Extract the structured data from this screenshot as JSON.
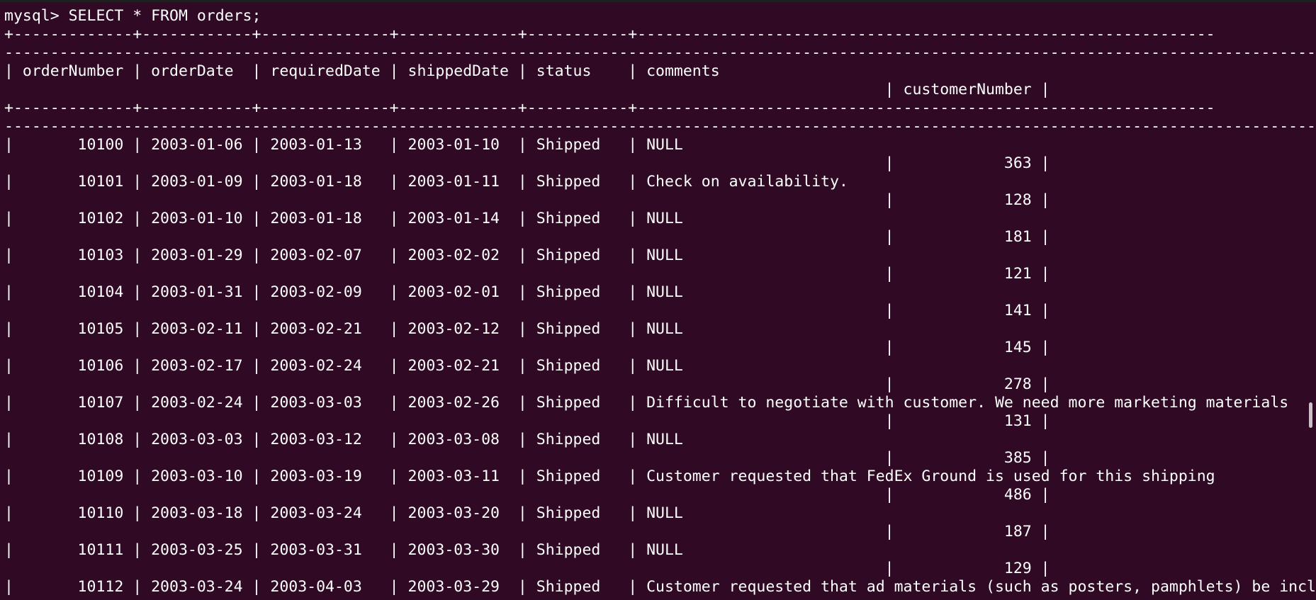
{
  "terminal": {
    "prompt": "mysql>",
    "command": "SELECT * FROM orders;",
    "border": "+-------------+------------+--------------+-------------+-----------+--------------------------------------------------------------------------------------------------------------------------------------------------------------------------------------------------------------------------------------------------------------+----------------+",
    "header_line1": "| orderNumber | orderDate  | requiredDate | shippedDate | status    | comments",
    "header_line2": "| customerNumber |",
    "scroll_position": 0.7,
    "colors": {
      "background": "#300a24",
      "foreground": "#ffffff"
    }
  },
  "table": {
    "columns": [
      "orderNumber",
      "orderDate",
      "requiredDate",
      "shippedDate",
      "status",
      "comments",
      "customerNumber"
    ],
    "rows": [
      {
        "orderNumber": "10100",
        "orderDate": "2003-01-06",
        "requiredDate": "2003-01-13",
        "shippedDate": "2003-01-10",
        "status": "Shipped",
        "comments": "NULL",
        "customerNumber": "363"
      },
      {
        "orderNumber": "10101",
        "orderDate": "2003-01-09",
        "requiredDate": "2003-01-18",
        "shippedDate": "2003-01-11",
        "status": "Shipped",
        "comments": "Check on availability.",
        "customerNumber": "128"
      },
      {
        "orderNumber": "10102",
        "orderDate": "2003-01-10",
        "requiredDate": "2003-01-18",
        "shippedDate": "2003-01-14",
        "status": "Shipped",
        "comments": "NULL",
        "customerNumber": "181"
      },
      {
        "orderNumber": "10103",
        "orderDate": "2003-01-29",
        "requiredDate": "2003-02-07",
        "shippedDate": "2003-02-02",
        "status": "Shipped",
        "comments": "NULL",
        "customerNumber": "121"
      },
      {
        "orderNumber": "10104",
        "orderDate": "2003-01-31",
        "requiredDate": "2003-02-09",
        "shippedDate": "2003-02-01",
        "status": "Shipped",
        "comments": "NULL",
        "customerNumber": "141"
      },
      {
        "orderNumber": "10105",
        "orderDate": "2003-02-11",
        "requiredDate": "2003-02-21",
        "shippedDate": "2003-02-12",
        "status": "Shipped",
        "comments": "NULL",
        "customerNumber": "145"
      },
      {
        "orderNumber": "10106",
        "orderDate": "2003-02-17",
        "requiredDate": "2003-02-24",
        "shippedDate": "2003-02-21",
        "status": "Shipped",
        "comments": "NULL",
        "customerNumber": "278"
      },
      {
        "orderNumber": "10107",
        "orderDate": "2003-02-24",
        "requiredDate": "2003-03-03",
        "shippedDate": "2003-02-26",
        "status": "Shipped",
        "comments": "Difficult to negotiate with customer. We need more marketing materials",
        "customerNumber": "131"
      },
      {
        "orderNumber": "10108",
        "orderDate": "2003-03-03",
        "requiredDate": "2003-03-12",
        "shippedDate": "2003-03-08",
        "status": "Shipped",
        "comments": "NULL",
        "customerNumber": "385"
      },
      {
        "orderNumber": "10109",
        "orderDate": "2003-03-10",
        "requiredDate": "2003-03-19",
        "shippedDate": "2003-03-11",
        "status": "Shipped",
        "comments": "Customer requested that FedEx Ground is used for this shipping",
        "customerNumber": "486"
      },
      {
        "orderNumber": "10110",
        "orderDate": "2003-03-18",
        "requiredDate": "2003-03-24",
        "shippedDate": "2003-03-20",
        "status": "Shipped",
        "comments": "NULL",
        "customerNumber": "187"
      },
      {
        "orderNumber": "10111",
        "orderDate": "2003-03-25",
        "requiredDate": "2003-03-31",
        "shippedDate": "2003-03-30",
        "status": "Shipped",
        "comments": "NULL",
        "customerNumber": "129"
      },
      {
        "orderNumber": "10112",
        "orderDate": "2003-03-24",
        "requiredDate": "2003-04-03",
        "shippedDate": "2003-03-29",
        "status": "Shipped",
        "comments": "Customer requested that ad materials (such as posters, pamphlets) be included in",
        "customerNumber": ""
      }
    ]
  }
}
